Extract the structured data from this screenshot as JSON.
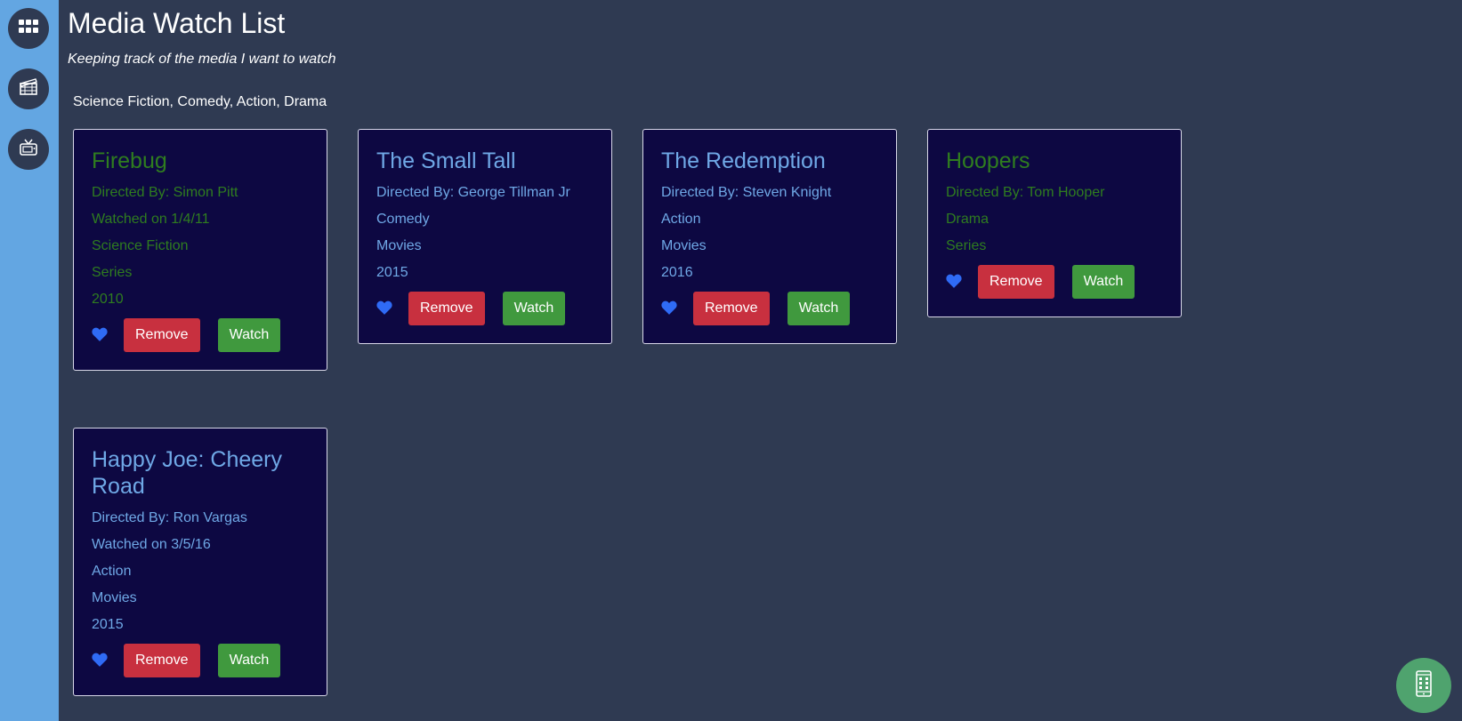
{
  "header": {
    "title": "Media Watch List",
    "subtitle": "Keeping track of the media I want to watch"
  },
  "genres_text": "Science Fiction, Comedy, Action, Drama",
  "sidebar": {
    "items": [
      {
        "icon": "grid-icon"
      },
      {
        "icon": "film-icon"
      },
      {
        "icon": "tv-icon"
      }
    ]
  },
  "buttons": {
    "remove": "Remove",
    "watch": "Watch"
  },
  "cards": [
    {
      "title": "Firebug",
      "directed": "Directed By: Simon Pitt",
      "watched": "Watched on 1/4/11",
      "genre": "Science Fiction",
      "type": "Series",
      "year": "2010",
      "color": "#2f7d1f"
    },
    {
      "title": "The Small Tall",
      "directed": "Directed By: George Tillman Jr",
      "genre": "Comedy",
      "type": "Movies",
      "year": "2015",
      "color": "#6fa8e6"
    },
    {
      "title": "The Redemption",
      "directed": "Directed By: Steven Knight",
      "genre": "Action",
      "type": "Movies",
      "year": "2016",
      "color": "#6fa8e6"
    },
    {
      "title": "Hoopers",
      "directed": "Directed By: Tom Hooper",
      "genre": "Drama",
      "type": "Series",
      "color": "#2f7d1f"
    },
    {
      "title": "Happy Joe: Cheery Road",
      "directed": "Directed By: Ron Vargas",
      "watched": "Watched on 3/5/16",
      "genre": "Action",
      "type": "Movies",
      "year": "2015",
      "color": "#6fa8e6"
    }
  ],
  "colors": {
    "background": "#2f3a52",
    "sidebar": "#63a6e2",
    "card": "#0d0842",
    "heart": "#2f6bf5",
    "remove": "#c8303f",
    "watch": "#40993e",
    "fab": "#4fa36e"
  },
  "fab": {
    "icon": "mobile-phone-icon"
  }
}
